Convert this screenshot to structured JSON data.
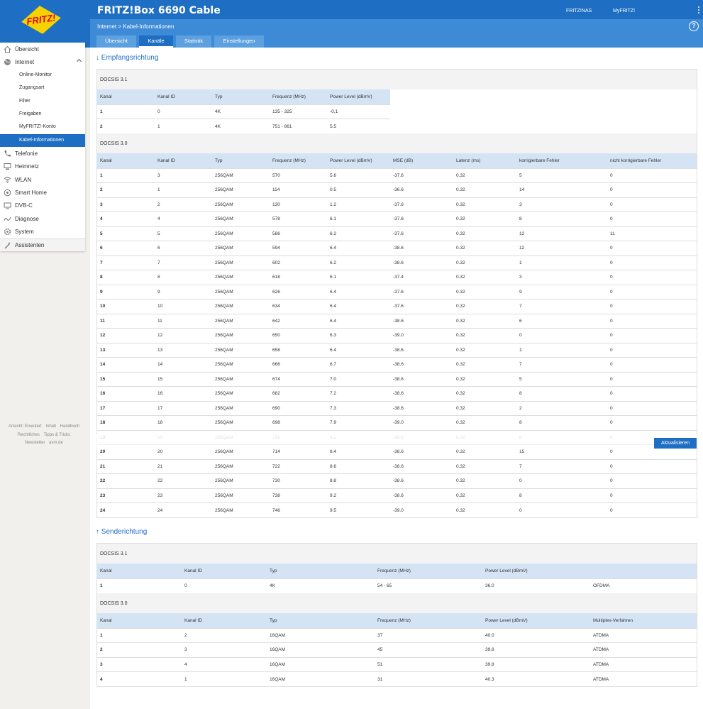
{
  "header": {
    "title": "FRITZ!Box 6690 Cable",
    "logo_text": "FRITZ!",
    "links": [
      "FRITZ!NAS",
      "MyFRITZ!"
    ],
    "breadcrumb": [
      "Internet",
      "Kabel-Informationen"
    ],
    "help_label": "?",
    "tabs": [
      "Übersicht",
      "Kanäle",
      "Statistik",
      "Einstellungen"
    ],
    "active_tab": "Kanäle"
  },
  "sidebar": {
    "items": [
      {
        "label": "Übersicht",
        "icon": "home-icon"
      },
      {
        "label": "Internet",
        "icon": "globe-icon"
      },
      {
        "label": "Telefonie",
        "icon": "phone-icon"
      },
      {
        "label": "Heimnetz",
        "icon": "network-icon"
      },
      {
        "label": "WLAN",
        "icon": "wifi-icon"
      },
      {
        "label": "Smart Home",
        "icon": "smart-home-icon"
      },
      {
        "label": "DVB-C",
        "icon": "tv-icon"
      },
      {
        "label": "Diagnose",
        "icon": "diagnose-icon"
      },
      {
        "label": "System",
        "icon": "system-icon"
      },
      {
        "label": "Assistenten",
        "icon": "wizard-icon"
      }
    ],
    "subitems": [
      "Online-Monitor",
      "Zugangsart",
      "Filter",
      "Freigaben",
      "MyFRITZ!-Konto",
      "Kabel-Informationen"
    ],
    "active_subitem": "Kabel-Informationen"
  },
  "footer": {
    "line1": [
      "Ansicht: Erweitert",
      "Inhalt",
      "Handbuch"
    ],
    "line2": [
      "Rechtliches",
      "Tipps & Tricks"
    ],
    "line3": [
      "Newsletter",
      "avm.de"
    ]
  },
  "downstream": {
    "title": "↓ Empfangsrichtung",
    "docsis31": {
      "label": "DOCSIS 3.1",
      "columns": [
        "Kanal",
        "Kanal ID",
        "Typ",
        "Frequenz (MHz)",
        "Power Level (dBmV)"
      ],
      "rows": [
        [
          "1",
          "0",
          "4K",
          "135 - 325",
          "-0,1"
        ],
        [
          "2",
          "1",
          "4K",
          "751 - 861",
          "5,5"
        ]
      ]
    },
    "docsis30": {
      "label": "DOCSIS 3.0",
      "columns": [
        "Kanal",
        "Kanal ID",
        "Typ",
        "Frequenz (MHz)",
        "Power Level (dBmV)",
        "MSE (dB)",
        "Latenz (ms)",
        "korrigierbare Fehler",
        "nicht korrigierbare Fehler"
      ],
      "rows": [
        [
          "1",
          "3",
          "256QAM",
          "570",
          "5.6",
          "-37.6",
          "0.32",
          "5",
          "0"
        ],
        [
          "2",
          "1",
          "256QAM",
          "114",
          "0.5",
          "-36.6",
          "0.32",
          "14",
          "0"
        ],
        [
          "3",
          "2",
          "256QAM",
          "130",
          "1.2",
          "-37.6",
          "0.32",
          "3",
          "0"
        ],
        [
          "4",
          "4",
          "256QAM",
          "578",
          "6.1",
          "-37.6",
          "0.32",
          "8",
          "0"
        ],
        [
          "5",
          "5",
          "256QAM",
          "586",
          "6.2",
          "-37.6",
          "0.32",
          "12",
          "11"
        ],
        [
          "6",
          "6",
          "256QAM",
          "594",
          "6.4",
          "-38.6",
          "0.32",
          "12",
          "0"
        ],
        [
          "7",
          "7",
          "256QAM",
          "602",
          "6.2",
          "-38.6",
          "0.32",
          "1",
          "0"
        ],
        [
          "8",
          "8",
          "256QAM",
          "618",
          "6.1",
          "-37.4",
          "0.32",
          "3",
          "0"
        ],
        [
          "9",
          "9",
          "256QAM",
          "626",
          "6.4",
          "-37.6",
          "0.32",
          "9",
          "0"
        ],
        [
          "10",
          "10",
          "256QAM",
          "634",
          "6.4",
          "-37.6",
          "0.32",
          "7",
          "0"
        ],
        [
          "11",
          "11",
          "256QAM",
          "642",
          "6.4",
          "-38.6",
          "0.32",
          "6",
          "0"
        ],
        [
          "12",
          "12",
          "256QAM",
          "650",
          "6.3",
          "-39.0",
          "0.32",
          "0",
          "0"
        ],
        [
          "13",
          "13",
          "256QAM",
          "658",
          "6.4",
          "-38.6",
          "0.32",
          "1",
          "0"
        ],
        [
          "14",
          "14",
          "256QAM",
          "666",
          "6.7",
          "-38.6",
          "0.32",
          "7",
          "0"
        ],
        [
          "15",
          "15",
          "256QAM",
          "674",
          "7.0",
          "-38.6",
          "0.32",
          "5",
          "0"
        ],
        [
          "16",
          "16",
          "256QAM",
          "682",
          "7.2",
          "-38.6",
          "0.32",
          "8",
          "0"
        ],
        [
          "17",
          "17",
          "256QAM",
          "690",
          "7.3",
          "-38.6",
          "0.32",
          "2",
          "0"
        ],
        [
          "18",
          "18",
          "256QAM",
          "698",
          "7.9",
          "-39.0",
          "0.32",
          "8",
          "0"
        ],
        [
          "19",
          "19",
          "256QAM",
          "706",
          "8.2",
          "-38.6",
          "0.32",
          "8",
          "0"
        ],
        [
          "20",
          "20",
          "256QAM",
          "714",
          "8.4",
          "-38.6",
          "0.32",
          "15",
          "0"
        ],
        [
          "21",
          "21",
          "256QAM",
          "722",
          "8.6",
          "-38.6",
          "0.32",
          "7",
          "0"
        ],
        [
          "22",
          "22",
          "256QAM",
          "730",
          "8.8",
          "-38.6",
          "0.32",
          "0",
          "0"
        ],
        [
          "23",
          "23",
          "256QAM",
          "738",
          "9.2",
          "-38.6",
          "0.32",
          "8",
          "0"
        ],
        [
          "24",
          "24",
          "256QAM",
          "746",
          "9.5",
          "-39.0",
          "0.32",
          "0",
          "0"
        ]
      ]
    }
  },
  "upstream": {
    "title": "↑ Senderichtung",
    "docsis31": {
      "label": "DOCSIS 3.1",
      "columns": [
        "Kanal",
        "Kanal ID",
        "Typ",
        "Frequenz (MHz)",
        "Power Level (dBmV)",
        ""
      ],
      "rows": [
        [
          "1",
          "0",
          "4K",
          "54 - 65",
          "36.0",
          "OFDMA"
        ]
      ]
    },
    "docsis30": {
      "label": "DOCSIS 3.0",
      "columns": [
        "Kanal",
        "Kanal ID",
        "Typ",
        "Frequenz (MHz)",
        "Power Level (dBmV)",
        "Multiplex-Verfahren"
      ],
      "rows": [
        [
          "1",
          "2",
          "16QAM",
          "37",
          "40.0",
          "ATDMA"
        ],
        [
          "2",
          "3",
          "16QAM",
          "45",
          "39.8",
          "ATDMA"
        ],
        [
          "3",
          "4",
          "16QAM",
          "51",
          "39.8",
          "ATDMA"
        ],
        [
          "4",
          "1",
          "16QAM",
          "31",
          "40.3",
          "ATDMA"
        ]
      ]
    }
  },
  "refresh_label": "Aktualisieren"
}
